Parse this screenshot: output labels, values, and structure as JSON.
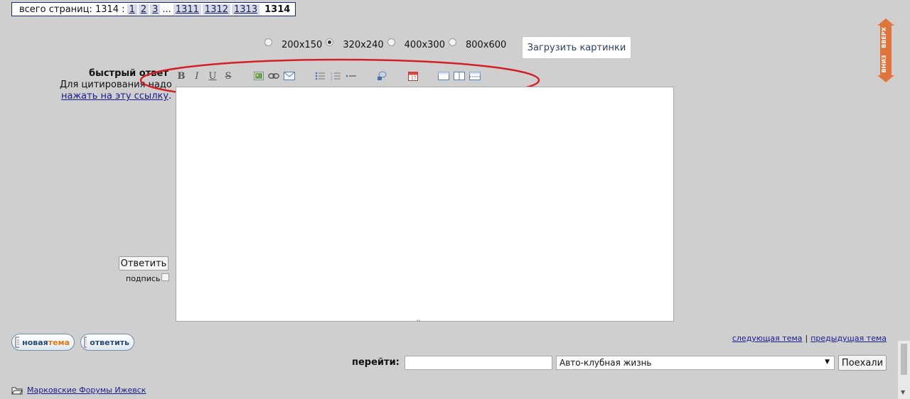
{
  "pagination": {
    "label": "всего страниц: 1314 :",
    "pages": [
      "1",
      "2",
      "3"
    ],
    "ellipsis": "...",
    "tail_pages": [
      "1311",
      "1312",
      "1313"
    ],
    "current": "1314"
  },
  "image_sizes": {
    "options": [
      {
        "label": "200x150",
        "selected": false
      },
      {
        "label": "320x240",
        "selected": true
      },
      {
        "label": "400x300",
        "selected": false
      },
      {
        "label": "800x600",
        "selected": false
      }
    ],
    "upload_button": "Загрузить картинки"
  },
  "quick_reply": {
    "title": "быстрый ответ",
    "quote_note": "Для цитирования надо",
    "quote_link": "нажать на эту ссылку",
    "quote_link_suffix": ".",
    "answer_button": "Ответить",
    "signature_label": "подпись",
    "signature_checked": false,
    "text_value": ""
  },
  "toolbar": {
    "buttons": [
      "bold-icon",
      "italic-icon",
      "underline-icon",
      "strikethrough-icon",
      "image-icon",
      "link-icon",
      "email-icon",
      "bullet-list-icon",
      "numbered-list-icon",
      "horizontal-rule-icon",
      "spoiler-icon",
      "calendar-icon",
      "quote-box-icon",
      "two-column-icon",
      "table-icon"
    ],
    "bold": "B",
    "italic": "I",
    "underline": "U",
    "strike": "S"
  },
  "bottom_buttons": {
    "new_topic_prefix": "новая",
    "new_topic_accent": "тема",
    "reply": "ответить"
  },
  "topic_nav": {
    "next": "следующая тема",
    "separator": "|",
    "prev": "предыдущая тема"
  },
  "goto": {
    "label": "перейти:",
    "input_value": "",
    "selected_forum": "Авто-клубная жизнь",
    "button": "Поехали"
  },
  "breadcrumb": {
    "forum": "Марковские Форумы Ижевск"
  },
  "side_nav": {
    "up": "ВВЕРХ",
    "down": "ВНИЗ"
  },
  "colors": {
    "background": "#cfcfcf",
    "annotation": "#d32027",
    "side_nav": "#e0743a",
    "link": "#1a1a8a"
  }
}
